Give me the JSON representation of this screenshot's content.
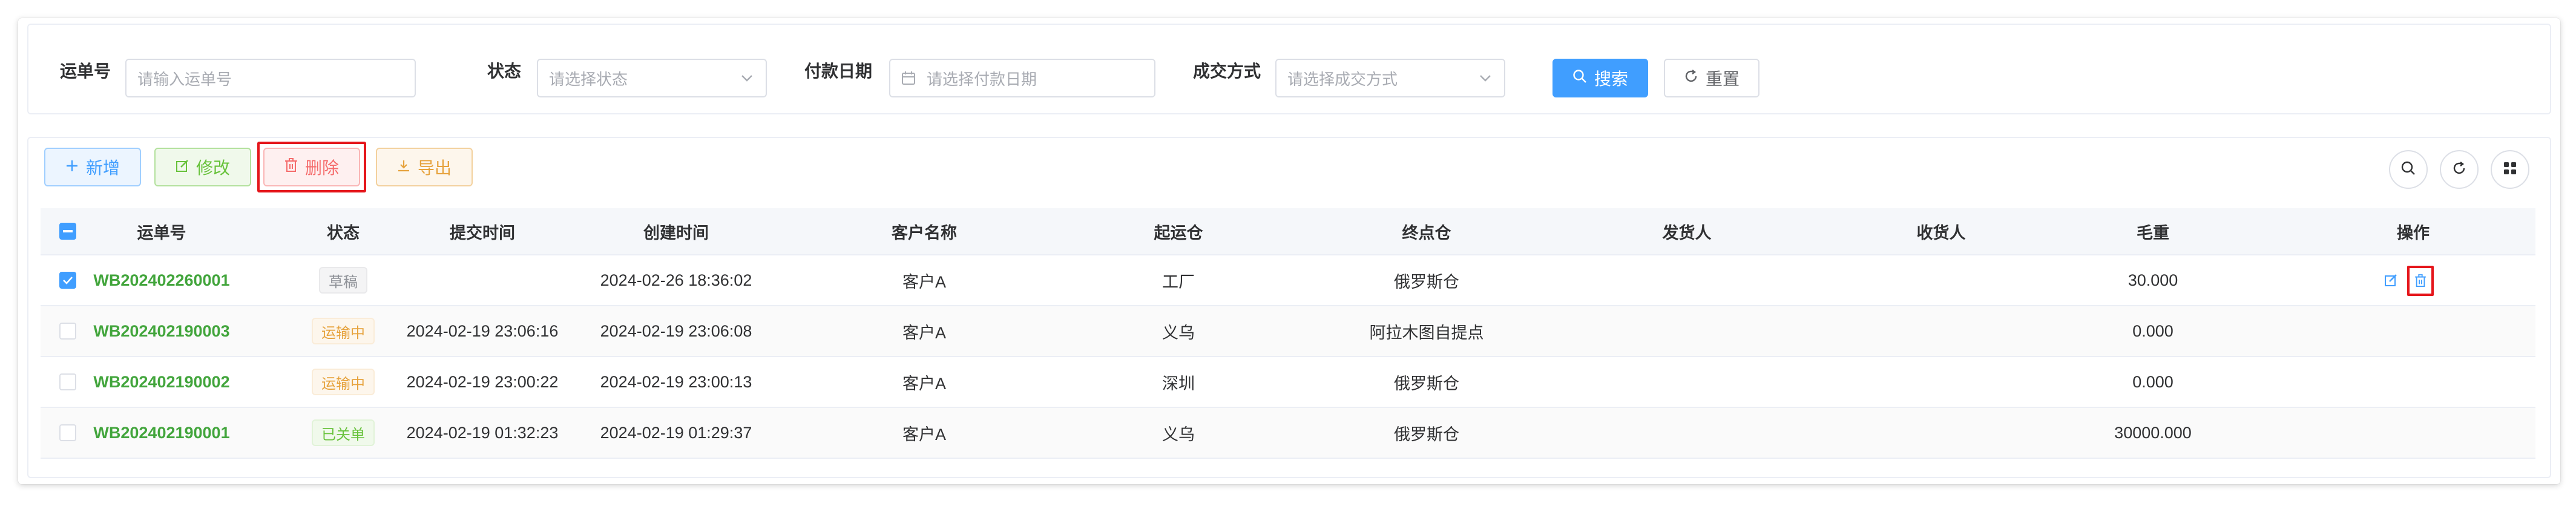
{
  "search": {
    "waybill_label": "运单号",
    "waybill_placeholder": "请输入运单号",
    "status_label": "状态",
    "status_placeholder": "请选择状态",
    "paydate_label": "付款日期",
    "paydate_placeholder": "请选择付款日期",
    "deal_label": "成交方式",
    "deal_placeholder": "请选择成交方式",
    "search_button": "搜索",
    "reset_button": "重置"
  },
  "toolbar": {
    "add": "新增",
    "edit": "修改",
    "delete": "删除",
    "export": "导出"
  },
  "table": {
    "headers": [
      "运单号",
      "状态",
      "提交时间",
      "创建时间",
      "客户名称",
      "起运仓",
      "终点仓",
      "发货人",
      "收货人",
      "毛重",
      "操作"
    ],
    "rows": [
      {
        "waybill": "WB202402260001",
        "status": "草稿",
        "status_type": "info",
        "submit_time": "",
        "create_time": "2024-02-26 18:36:02",
        "customer": "客户A",
        "origin": "工厂",
        "destination": "俄罗斯仓",
        "shipper": "",
        "consignee": "",
        "weight": "30.000",
        "selected": true
      },
      {
        "waybill": "WB202402190003",
        "status": "运输中",
        "status_type": "warn",
        "submit_time": "2024-02-19 23:06:16",
        "create_time": "2024-02-19 23:06:08",
        "customer": "客户A",
        "origin": "义乌",
        "destination": "阿拉木图自提点",
        "shipper": "",
        "consignee": "",
        "weight": "0.000",
        "selected": false
      },
      {
        "waybill": "WB202402190002",
        "status": "运输中",
        "status_type": "warn",
        "submit_time": "2024-02-19 23:00:22",
        "create_time": "2024-02-19 23:00:13",
        "customer": "客户A",
        "origin": "深圳",
        "destination": "俄罗斯仓",
        "shipper": "",
        "consignee": "",
        "weight": "0.000",
        "selected": false
      },
      {
        "waybill": "WB202402190001",
        "status": "已关单",
        "status_type": "ok",
        "submit_time": "2024-02-19 01:32:23",
        "create_time": "2024-02-19 01:29:37",
        "customer": "客户A",
        "origin": "义乌",
        "destination": "俄罗斯仓",
        "shipper": "",
        "consignee": "",
        "weight": "30000.000",
        "selected": false
      }
    ]
  },
  "colors": {
    "primary": "#409eff",
    "success": "#67c23a",
    "danger": "#f56c6c",
    "warning": "#e6a23c",
    "highlight": "#e5161b"
  }
}
